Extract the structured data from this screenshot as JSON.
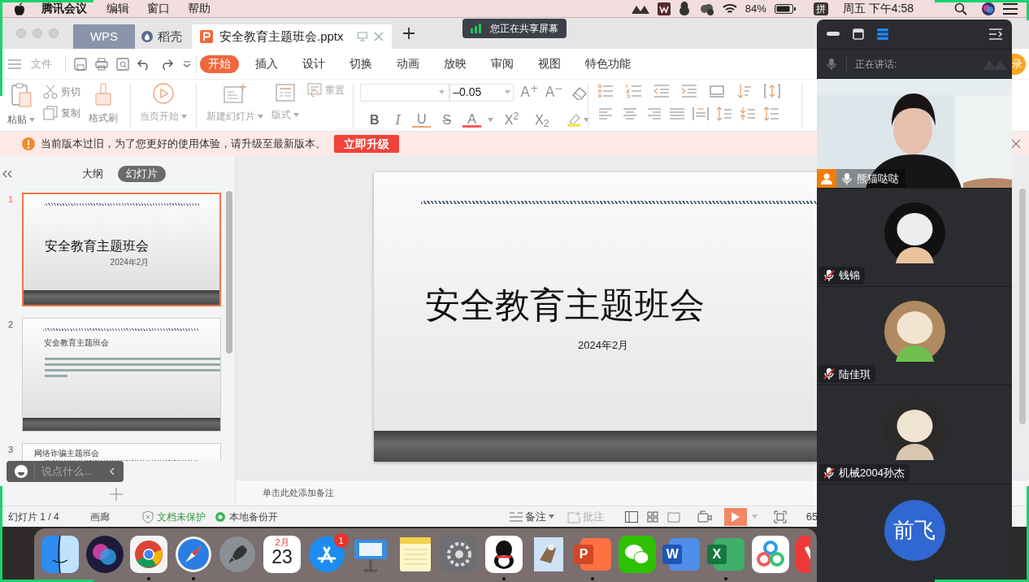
{
  "menubar": {
    "app": "腾讯会议",
    "menus": [
      "编辑",
      "窗口",
      "帮助"
    ],
    "battery": "84%",
    "input_method": "拼",
    "clock": "周五 下午4:58"
  },
  "share_badge": "您正在共享屏幕",
  "tabs": [
    {
      "label": "WPS",
      "kind": "home",
      "selected": false
    },
    {
      "label": "稻壳",
      "kind": "docer",
      "selected": false
    },
    {
      "label": "安全教育主题班会.pptx",
      "kind": "document",
      "selected": true
    }
  ],
  "file_menu": "文件",
  "ribbon_tabs": [
    {
      "label": "开始",
      "selected": true
    },
    {
      "label": "插入",
      "selected": false
    },
    {
      "label": "设计",
      "selected": false
    },
    {
      "label": "切换",
      "selected": false
    },
    {
      "label": "动画",
      "selected": false
    },
    {
      "label": "放映",
      "selected": false
    },
    {
      "label": "审阅",
      "selected": false
    },
    {
      "label": "视图",
      "selected": false
    },
    {
      "label": "特色功能",
      "selected": false
    }
  ],
  "record_button": "录",
  "ribbon": {
    "paste": "粘贴",
    "cut": "剪切",
    "copy": "复制",
    "format_painter": "格式刷",
    "play_from_current": "当页开始",
    "new_slide": "新建幻灯片",
    "layout": "版式",
    "reset": "重置",
    "font_size": "–0.05"
  },
  "font_size_buttons": [
    "A$^{+}$",
    "A$^{−}$"
  ],
  "format_buttons": [
    {
      "label": "B",
      "kind": "bold"
    },
    {
      "label": "I",
      "kind": "italic"
    },
    {
      "label": "U",
      "kind": "underline"
    },
    {
      "label": "S",
      "kind": "strike"
    },
    {
      "label": "A",
      "kind": "color"
    },
    {
      "label": "X$^{2}$",
      "kind": "superscript"
    },
    {
      "label": "X$_{2}$",
      "kind": "subscript"
    }
  ],
  "notice": {
    "text": "当前版本过旧，为了您更好的使用体验，请升级至最新版本。",
    "button": "立即升级"
  },
  "panel_tabs": [
    {
      "label": "大纲",
      "selected": false
    },
    {
      "label": "幻灯片",
      "selected": true
    }
  ],
  "slides": [
    {
      "number": "1",
      "selected": true,
      "kind": "title",
      "title": "安全教育主题班会",
      "subtitle": "2024年2月"
    },
    {
      "number": "2",
      "selected": false,
      "kind": "bullets",
      "title": "安全教育主题班会"
    },
    {
      "number": "3",
      "selected": false,
      "kind": "partial",
      "title": "网络诈骗主题班会"
    }
  ],
  "chat_input": {
    "placeholder": "说点什么..."
  },
  "main_slide": {
    "title": "安全教育主题班会",
    "subtitle": "2024年2月"
  },
  "notes_placeholder": "单击此处添加备注",
  "status_bar": {
    "slide_counter": "幻灯片 1 / 4",
    "gallery": "画廊",
    "protection": "文档未保护",
    "backup": "本地备份开",
    "notes": "备注",
    "comments": "批注",
    "zoom": "65"
  },
  "dock": [
    {
      "kind": "finder",
      "running": false
    },
    {
      "kind": "siri",
      "running": false
    },
    {
      "kind": "chrome",
      "running": true
    },
    {
      "kind": "safari",
      "running": true
    },
    {
      "kind": "launchpad",
      "running": false
    },
    {
      "kind": "calendar",
      "month": "2月",
      "day": "23",
      "running": false
    },
    {
      "kind": "appstore",
      "badge": "1",
      "running": false
    },
    {
      "kind": "keynote",
      "running": false
    },
    {
      "kind": "notes",
      "running": false
    },
    {
      "kind": "settings",
      "running": false
    },
    {
      "kind": "qq",
      "running": true
    },
    {
      "kind": "mail",
      "running": false
    },
    {
      "kind": "powerpoint",
      "letter": "P",
      "running": true
    },
    {
      "kind": "wechat",
      "running": false
    },
    {
      "kind": "word",
      "letter": "W",
      "running": false
    },
    {
      "kind": "excel",
      "letter": "X",
      "running": true
    },
    {
      "kind": "cloud",
      "running": false
    },
    {
      "kind": "vivaldi",
      "running": false
    }
  ],
  "meeting": {
    "speaking_label": "正在讲话:",
    "participants": [
      {
        "kind": "video",
        "name": "熊猫哒哒",
        "muted": false
      },
      {
        "kind": "avatar",
        "name": "钱锦",
        "muted": true
      },
      {
        "kind": "avatar",
        "name": "陆佳琪",
        "muted": true
      },
      {
        "kind": "avatar",
        "name": "机械2004孙杰",
        "muted": true
      },
      {
        "kind": "initials",
        "initials": "前飞"
      }
    ]
  }
}
